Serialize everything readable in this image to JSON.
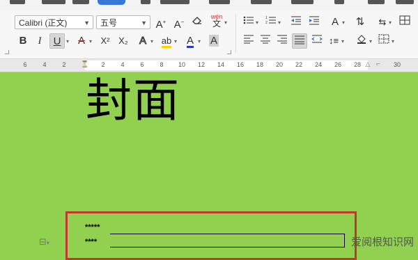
{
  "ribbon": {
    "font_name": "Calibri (正文)",
    "font_size": "五号",
    "pinyin_label": "wén",
    "buttons": {
      "bold": "B",
      "italic": "I",
      "underline": "U",
      "strike": "A",
      "superscript": "X²",
      "subscript": "X₂",
      "font_color": "A",
      "char_shade": "A"
    }
  },
  "ruler": {
    "ticks": [
      "6",
      "4",
      "2",
      "2",
      "4",
      "6",
      "8",
      "10",
      "12",
      "14",
      "16",
      "18",
      "20",
      "22",
      "24",
      "26",
      "28",
      "30"
    ]
  },
  "document": {
    "title": "封面",
    "fields": [
      {
        "label": "*****"
      },
      {
        "label": "****"
      }
    ]
  },
  "watermark": "爱阅根知识网",
  "colors": {
    "page_background": "#92d050",
    "highlight_box": "#c0392b",
    "accent_tab": "#3a78d8"
  }
}
